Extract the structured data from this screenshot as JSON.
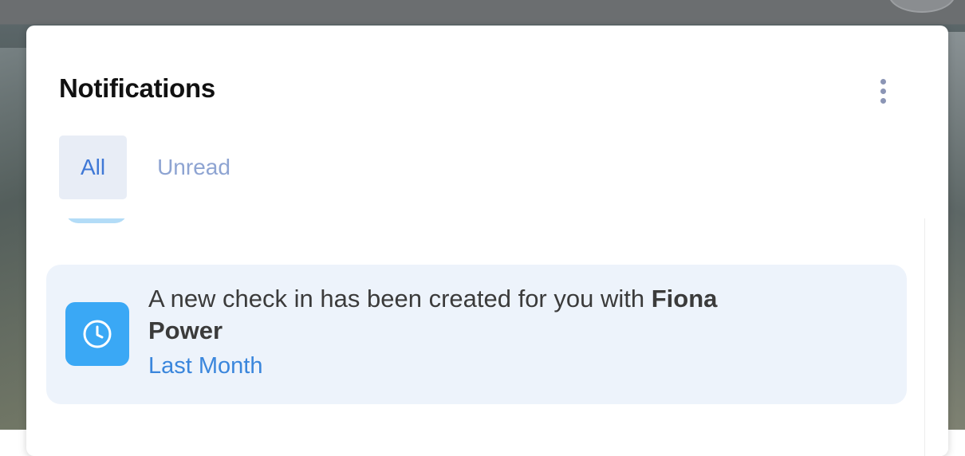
{
  "header": {
    "title": "Notifications",
    "more_icon": "more-vertical-icon"
  },
  "tabs": [
    {
      "label": "All",
      "active": true
    },
    {
      "label": "Unread",
      "active": false
    }
  ],
  "notifications": [
    {
      "icon": "clock-icon",
      "message_prefix": "A new check in has been created for you with ",
      "message_name": "Fiona Power",
      "time": "Last Month"
    }
  ],
  "colors": {
    "accent": "#3f78d6",
    "icon_bg": "#3aa8f5",
    "item_bg": "#edf3fb",
    "tab_active_bg": "#e8edf6",
    "time_text": "#3a86dc"
  }
}
